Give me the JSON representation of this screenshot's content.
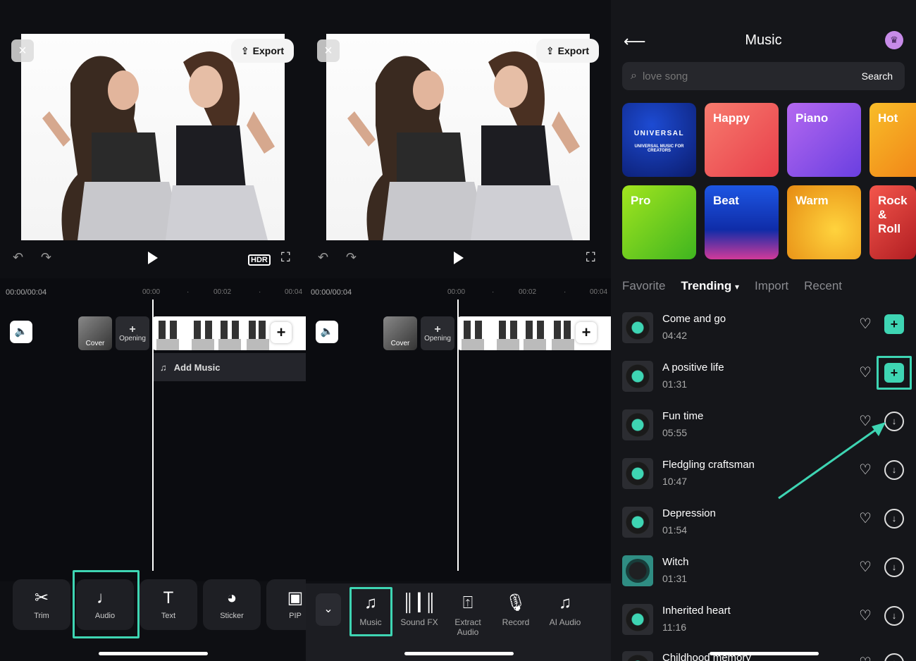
{
  "colors": {
    "accent": "#3ed5b3",
    "highlight": "#3ed5b3"
  },
  "editor": {
    "close_icon": "×",
    "export_label": "Export",
    "time_current": "00:00/00:04",
    "marks": [
      "00:00",
      "00:02",
      "00:04"
    ],
    "cover_label": "Cover",
    "opening_label": "Opening",
    "add_music_label": "Add Music"
  },
  "toolbar1": [
    {
      "label": "Trim",
      "icon": "scissors-icon"
    },
    {
      "label": "Audio",
      "icon": "music-note-icon"
    },
    {
      "label": "Text",
      "icon": "text-icon"
    },
    {
      "label": "Sticker",
      "icon": "sticker-icon"
    },
    {
      "label": "PIP",
      "icon": "picture-icon"
    }
  ],
  "toolbar2": [
    {
      "label": "Music",
      "icon": "music-notes-icon"
    },
    {
      "label": "Sound FX",
      "icon": "waveform-icon"
    },
    {
      "label": "Extract Audio",
      "icon": "extract-audio-icon"
    },
    {
      "label": "Record",
      "icon": "microphone-icon"
    },
    {
      "label": "AI Audio",
      "icon": "ai-audio-icon"
    }
  ],
  "music": {
    "title": "Music",
    "search_placeholder": "love song",
    "search_button": "Search",
    "categories": [
      {
        "label": "UNIVERSAL",
        "sub": "UNIVERSAL MUSIC FOR CREATORS"
      },
      {
        "label": "Happy"
      },
      {
        "label": "Piano"
      },
      {
        "label": "Hot"
      },
      {
        "label": "Pro"
      },
      {
        "label": "Beat"
      },
      {
        "label": "Warm"
      },
      {
        "label": "Rock & Roll"
      }
    ],
    "tabs": [
      "Favorite",
      "Trending",
      "Import",
      "Recent"
    ],
    "active_tab": "Trending",
    "songs": [
      {
        "name": "Come and go",
        "duration": "04:42",
        "action": "add"
      },
      {
        "name": "A positive life",
        "duration": "01:31",
        "action": "add"
      },
      {
        "name": "Fun time",
        "duration": "05:55",
        "action": "download"
      },
      {
        "name": "Fledgling craftsman",
        "duration": "10:47",
        "action": "download"
      },
      {
        "name": "Depression",
        "duration": "01:54",
        "action": "download"
      },
      {
        "name": "Witch",
        "duration": "01:31",
        "action": "download"
      },
      {
        "name": "Inherited heart",
        "duration": "11:16",
        "action": "download"
      },
      {
        "name": "Childhood memory",
        "duration": "",
        "action": "download"
      }
    ]
  }
}
